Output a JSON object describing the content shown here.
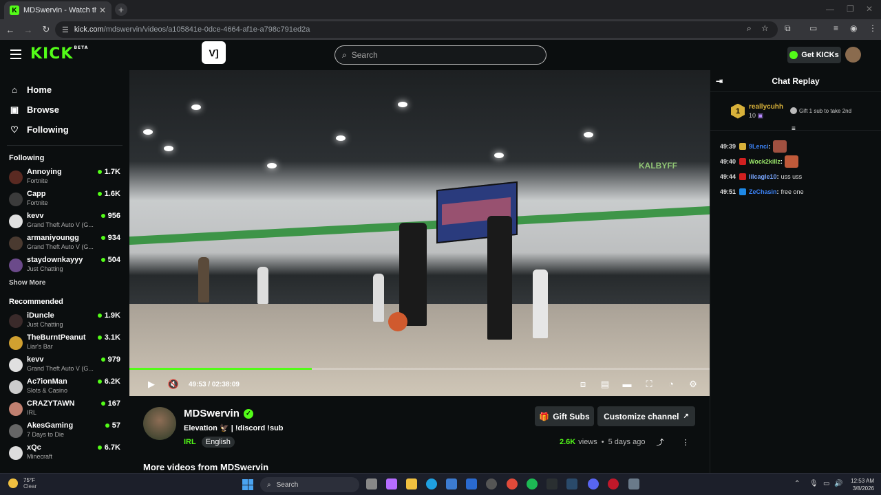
{
  "browser": {
    "tab_title": "MDSwervin - Watch the VOD o",
    "url_scheme": "",
    "url_host": "kick.com",
    "url_path": "/mdswervin/videos/a105841e-0dce-4664-af1e-a798c791ed2a"
  },
  "header": {
    "logo": "KICK",
    "beta": "BETA",
    "search_placeholder": "Search",
    "get_kicks": "Get KICKs"
  },
  "sidebar": {
    "nav": [
      {
        "label": "Home",
        "icon": "home-icon"
      },
      {
        "label": "Browse",
        "icon": "browse-icon"
      },
      {
        "label": "Following",
        "icon": "heart-icon"
      }
    ],
    "following_title": "Following",
    "following": [
      {
        "name": "Annoying",
        "category": "Fortnite",
        "viewers": "1.7K",
        "color": "#5a2a22"
      },
      {
        "name": "Capp",
        "category": "Fortnite",
        "viewers": "1.6K",
        "color": "#3b3b3b"
      },
      {
        "name": "kevv",
        "category": "Grand Theft Auto V (G...",
        "viewers": "956",
        "color": "#e0e0e0"
      },
      {
        "name": "armaniyoungg",
        "category": "Grand Theft Auto V (G...",
        "viewers": "934",
        "color": "#4a3a30"
      },
      {
        "name": "staydownkayyy",
        "category": "Just Chatting",
        "viewers": "504",
        "color": "#6b4a8a"
      }
    ],
    "show_more": "Show More",
    "recommended_title": "Recommended",
    "recommended": [
      {
        "name": "iDuncle",
        "category": "Just Chatting",
        "viewers": "1.9K",
        "color": "#3a2a2a"
      },
      {
        "name": "TheBurntPeanut",
        "category": "Liar's Bar",
        "viewers": "3.1K",
        "color": "#d0a030"
      },
      {
        "name": "kevv",
        "category": "Grand Theft Auto V (G...",
        "viewers": "979",
        "color": "#e0e0e0"
      },
      {
        "name": "Ac7ionMan",
        "category": "Slots & Casino",
        "viewers": "6.2K",
        "color": "#cccccc"
      },
      {
        "name": "CRAZYTAWN",
        "category": "IRL",
        "viewers": "167",
        "color": "#c08070"
      },
      {
        "name": "AkesGaming",
        "category": "7 Days to Die",
        "viewers": "57",
        "color": "#666666"
      },
      {
        "name": "xQc",
        "category": "Minecraft",
        "viewers": "6.7K",
        "color": "#dddddd"
      }
    ]
  },
  "video": {
    "watermark": "KALBYFF",
    "current_time": "49:53",
    "separator": "/",
    "duration": "02:38:09",
    "progress": 0.3148
  },
  "channel": {
    "name": "MDSwervin",
    "title": "Elevation 🦅 | !discord !sub",
    "category": "IRL",
    "language": "English",
    "gift_subs": "Gift Subs",
    "customize": "Customize channel",
    "views": "2.6K",
    "views_label": "views",
    "bullet": "•",
    "age": "5 days ago",
    "more_videos": "More videos from MDSwervin"
  },
  "chat": {
    "title": "Chat Replay",
    "pinned": {
      "rank": "1",
      "user": "reallycuhh",
      "count": "10",
      "gift_text": "Gift 1 sub to take 2nd"
    },
    "messages": [
      {
        "time": "49:39",
        "user": "9Lenci",
        "user_color": "#3b82f6",
        "badge_color": "#d8b13a",
        "text": "",
        "emote_color": "#a05040"
      },
      {
        "time": "49:40",
        "user": "Wock2killz",
        "user_color": "#9be86a",
        "badge_color": "#d02020",
        "text": "",
        "emote_color": "#c05a3a"
      },
      {
        "time": "49:44",
        "user": "lilcagle10",
        "user_color": "#7aa7ff",
        "badge_color": "#d02020",
        "text": "uss uss",
        "emote_color": ""
      },
      {
        "time": "49:51",
        "user": "ZeChasin",
        "user_color": "#3b82f6",
        "badge_color": "#1e88e5",
        "text": "free one",
        "emote_color": ""
      }
    ]
  },
  "taskbar": {
    "temp": "75°F",
    "condition": "Clear",
    "search": "Search",
    "time": "12:53 AM",
    "date": "3/8/2026"
  }
}
